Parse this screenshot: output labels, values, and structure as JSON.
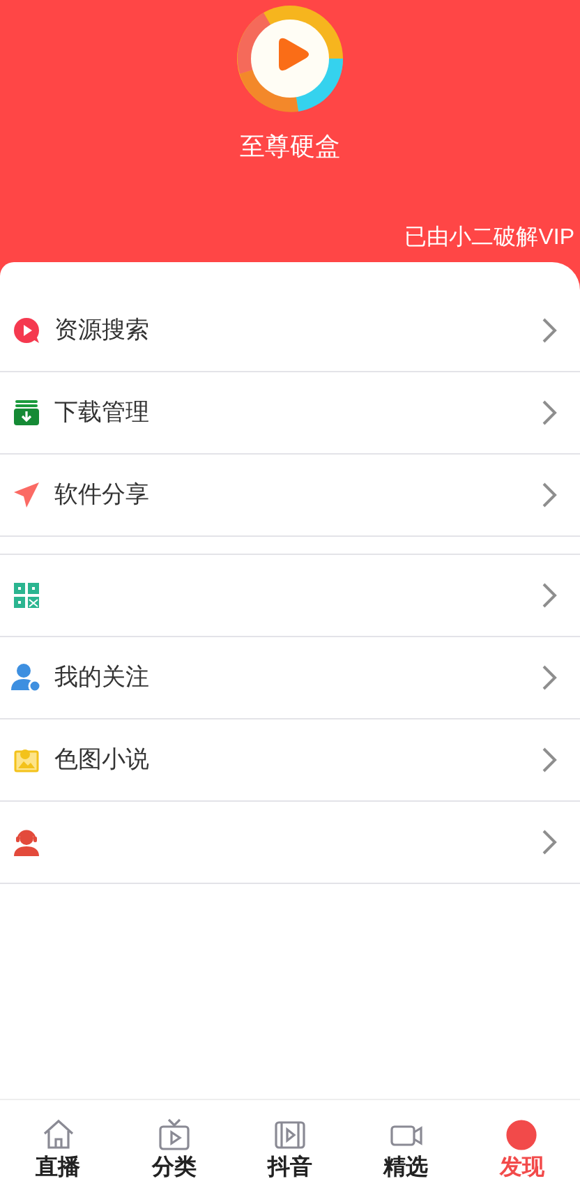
{
  "header": {
    "app_name": "至尊硬盒",
    "vip_note": "已由小二破解VIP"
  },
  "menu_groups": [
    {
      "items": [
        {
          "kind": "search",
          "label": "资源搜索"
        },
        {
          "kind": "download",
          "label": "下载管理"
        },
        {
          "kind": "share",
          "label": "软件分享"
        }
      ]
    },
    {
      "items": [
        {
          "kind": "grid"
        },
        {
          "kind": "follow",
          "label": "我的关注"
        },
        {
          "kind": "gallery",
          "label": "色图小说"
        },
        {
          "kind": "support"
        }
      ]
    }
  ],
  "tabs": [
    {
      "label": "直播",
      "selected": false
    },
    {
      "label": "分类",
      "selected": false
    },
    {
      "label": "抖音",
      "selected": false
    },
    {
      "label": "精选",
      "selected": false
    },
    {
      "label": "发现",
      "selected": true
    }
  ]
}
